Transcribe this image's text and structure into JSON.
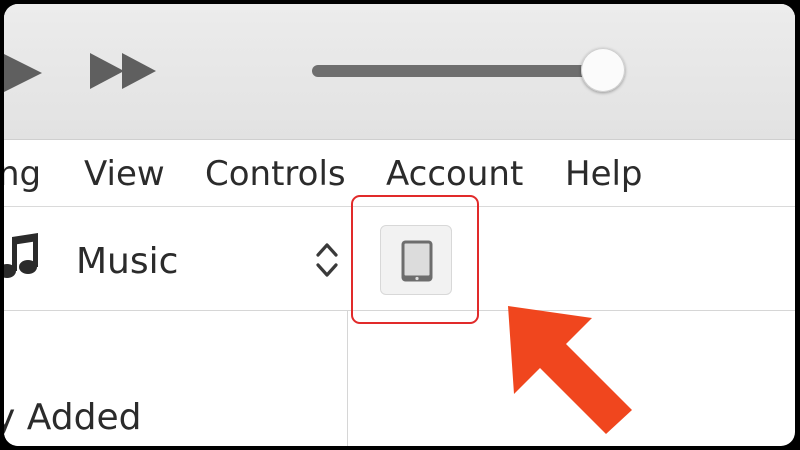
{
  "menu": {
    "items": [
      "ng",
      "View",
      "Controls",
      "Account",
      "Help"
    ]
  },
  "media": {
    "selected": "Music"
  },
  "sidebar": {
    "items": [
      "y Added"
    ]
  },
  "icons": {
    "play": "play-icon",
    "fast_forward": "fast-forward-icon",
    "music_note": "music-note-icon",
    "up_down": "up-down-chevron-icon",
    "device": "ipad-device-icon",
    "annotation_arrow": "arrow-pointer-icon"
  },
  "colors": {
    "highlight": "#e12a2a",
    "arrow": "#f0461e",
    "toolbar_bg": "#e6e6e6"
  }
}
